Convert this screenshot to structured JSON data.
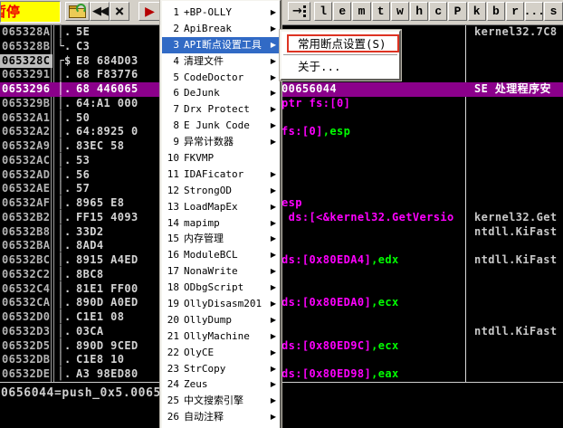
{
  "toolbar": {
    "status_text": "暂停",
    "restart_label": "◀◀",
    "close_label": "×",
    "run_label": "▶",
    "trace_arrow": "→",
    "window_buttons": [
      "l",
      "e",
      "m",
      "t",
      "w",
      "h",
      "c",
      "P",
      "k",
      "b",
      "r",
      "...",
      "s"
    ]
  },
  "plugin_menu": {
    "items": [
      {
        "num": "1",
        "label": "+BP-OLLY",
        "submenu": true
      },
      {
        "num": "2",
        "label": "ApiBreak",
        "submenu": true
      },
      {
        "num": "3",
        "label": "API断点设置工具",
        "submenu": true,
        "selected": true
      },
      {
        "num": "4",
        "label": "清理文件",
        "submenu": true
      },
      {
        "num": "5",
        "label": "CodeDoctor",
        "submenu": true
      },
      {
        "num": "6",
        "label": "DeJunk",
        "submenu": true
      },
      {
        "num": "7",
        "label": "Drx Protect",
        "submenu": true
      },
      {
        "num": "8",
        "label": "E Junk Code",
        "submenu": true
      },
      {
        "num": "9",
        "label": "异常计数器",
        "submenu": true
      },
      {
        "num": "10",
        "label": "FKVMP",
        "submenu": false
      },
      {
        "num": "11",
        "label": "IDAFicator",
        "submenu": true
      },
      {
        "num": "12",
        "label": "StrongOD",
        "submenu": true
      },
      {
        "num": "13",
        "label": "LoadMapEx",
        "submenu": true
      },
      {
        "num": "14",
        "label": "mapimp",
        "submenu": true
      },
      {
        "num": "15",
        "label": "内存管理",
        "submenu": true
      },
      {
        "num": "16",
        "label": "ModuleBCL",
        "submenu": true
      },
      {
        "num": "17",
        "label": "NonaWrite",
        "submenu": true
      },
      {
        "num": "18",
        "label": "ODbgScript",
        "submenu": true
      },
      {
        "num": "19",
        "label": "OllyDisasm201",
        "submenu": true
      },
      {
        "num": "20",
        "label": "OllyDump",
        "submenu": true
      },
      {
        "num": "21",
        "label": "OllyMachine",
        "submenu": true
      },
      {
        "num": "22",
        "label": "OlyCE",
        "submenu": true
      },
      {
        "num": "23",
        "label": "StrCopy",
        "submenu": true
      },
      {
        "num": "24",
        "label": "Zeus",
        "submenu": true
      },
      {
        "num": "25",
        "label": "中文搜索引擎",
        "submenu": true
      },
      {
        "num": "26",
        "label": "自动注释",
        "submenu": true
      }
    ],
    "arrow_glyph": "▶"
  },
  "submenu": {
    "items": [
      {
        "label": "常用断点设置(S)"
      },
      {
        "label": "关于..."
      }
    ]
  },
  "disassembly": {
    "rows": [
      {
        "addr": "065328A",
        "brace": "│",
        "mark": ".",
        "hex": "5E",
        "comment": "kernel32.7C8"
      },
      {
        "addr": "065328B",
        "brace": "└",
        "mark": ".",
        "hex": "C3"
      },
      {
        "addr": "065328C",
        "brace": "┌",
        "mark": "$",
        "hex": "E8 684D03",
        "addr_selected": true
      },
      {
        "addr": "0653291",
        "brace": "│",
        "mark": ".",
        "hex": "68 F83776"
      },
      {
        "addr": "0653296",
        "brace": "│",
        "mark": ".",
        "hex": "68 446065",
        "highlight": true,
        "code_w": "00656044",
        "comment": "SE 处理程序安"
      },
      {
        "addr": "065329B",
        "brace": "│",
        "mark": ".",
        "hex": "64:A1 000",
        "code_m": "ptr fs:[0]"
      },
      {
        "addr": "06532A1",
        "brace": "│",
        "mark": ".",
        "hex": "50"
      },
      {
        "addr": "06532A2",
        "brace": "│",
        "mark": ".",
        "hex": "64:8925 0",
        "code_m": "fs:[0]",
        "code_g": ",esp"
      },
      {
        "addr": "06532A9",
        "brace": "│",
        "mark": ".",
        "hex": "83EC 58"
      },
      {
        "addr": "06532AC",
        "brace": "│",
        "mark": ".",
        "hex": "53"
      },
      {
        "addr": "06532AD",
        "brace": "│",
        "mark": ".",
        "hex": "56"
      },
      {
        "addr": "06532AE",
        "brace": "│",
        "mark": ".",
        "hex": "57"
      },
      {
        "addr": "06532AF",
        "brace": "│",
        "mark": ".",
        "hex": "8965 E8",
        "code_m": "esp"
      },
      {
        "addr": "06532B2",
        "brace": "│",
        "mark": ".",
        "hex": "FF15 4093",
        "code_m": " ds:[<&kernel32.GetVersio",
        "comment": "kernel32.Get"
      },
      {
        "addr": "06532B8",
        "brace": "│",
        "mark": ".",
        "hex": "33D2",
        "comment": "ntdll.KiFast"
      },
      {
        "addr": "06532BA",
        "brace": "│",
        "mark": ".",
        "hex": "8AD4"
      },
      {
        "addr": "06532BC",
        "brace": "│",
        "mark": ".",
        "hex": "8915 A4ED",
        "code_m": "ds:[0x80EDA4]",
        "code_g": ",edx",
        "comment": "ntdll.KiFast"
      },
      {
        "addr": "06532C2",
        "brace": "│",
        "mark": ".",
        "hex": "8BC8"
      },
      {
        "addr": "06532C4",
        "brace": "│",
        "mark": ".",
        "hex": "81E1 FF00"
      },
      {
        "addr": "06532CA",
        "brace": "│",
        "mark": ".",
        "hex": "890D A0ED",
        "code_m": "ds:[0x80EDA0]",
        "code_g": ",ecx"
      },
      {
        "addr": "06532D0",
        "brace": "│",
        "mark": ".",
        "hex": "C1E1 08"
      },
      {
        "addr": "06532D3",
        "brace": "│",
        "mark": ".",
        "hex": "03CA",
        "comment": "ntdll.KiFast"
      },
      {
        "addr": "06532D5",
        "brace": "│",
        "mark": ".",
        "hex": "890D 9CED",
        "code_m": "ds:[0x80ED9C]",
        "code_g": ",ecx"
      },
      {
        "addr": "06532DB",
        "brace": "│",
        "mark": ".",
        "hex": "C1E8 10"
      },
      {
        "addr": "06532DE",
        "brace": "│",
        "mark": ".",
        "hex": "A3 98ED80",
        "code_m": "ds:[0x80ED98]",
        "code_g": ",eax"
      }
    ],
    "info_line": "0656044=push_0x5.0065"
  },
  "colors": {
    "accent_selection": "#316ac5",
    "highlight_row": "#8b008b",
    "operand_magenta": "#ff00ff",
    "register_green": "#00ff00",
    "status_red": "#ee0000",
    "annotation_red": "#dd3322"
  }
}
